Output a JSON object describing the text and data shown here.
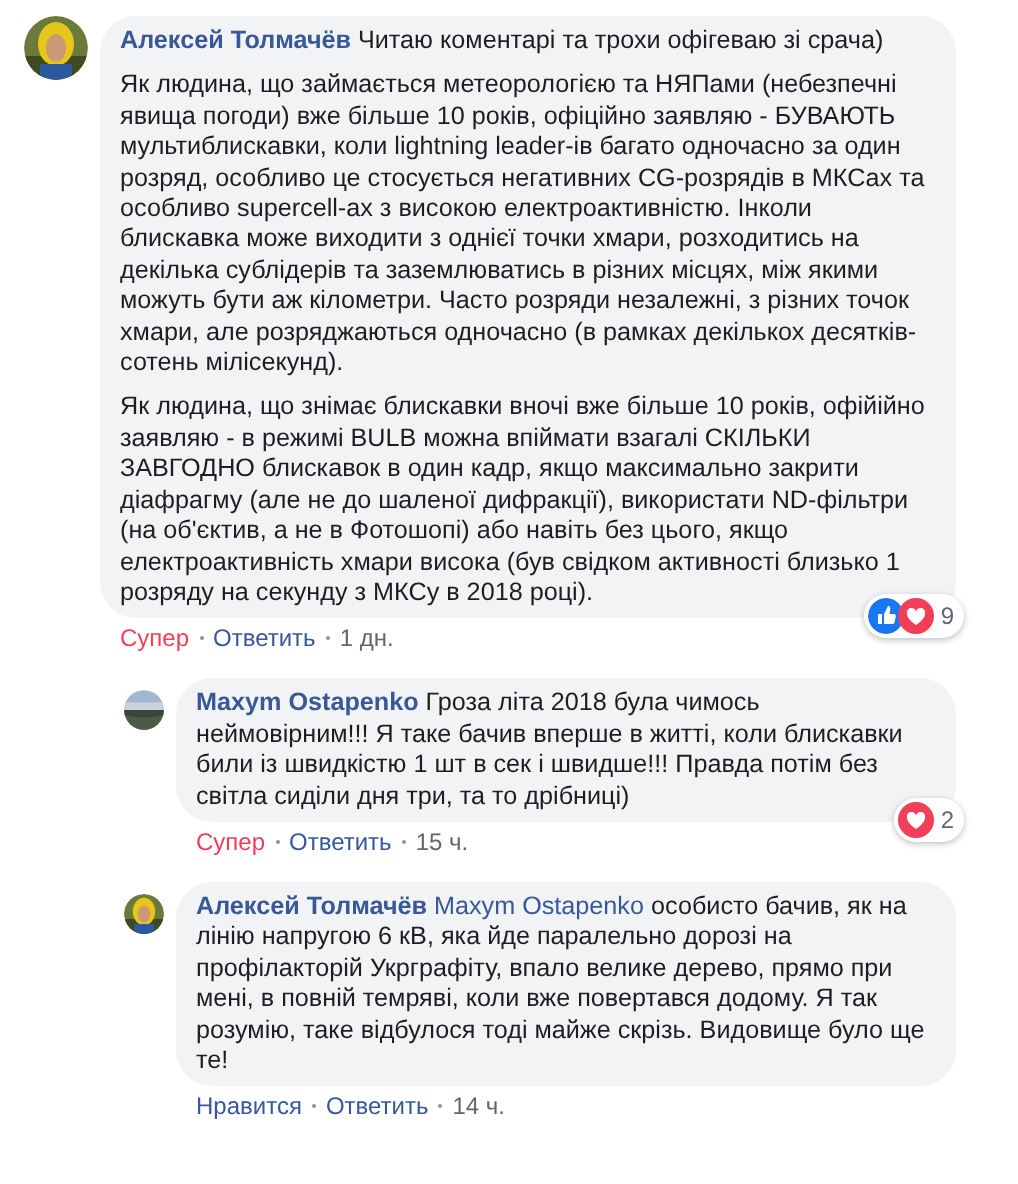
{
  "comments": [
    {
      "author": "Алексей Толмачёв",
      "paragraphs": [
        "Читаю коментарі та трохи офігеваю зі срача)",
        "Як людина, що займається метеорологією та НЯПами (небезпечні явища погоди) вже більше 10 років, офіційно заявляю - БУВАЮТЬ мультиблискавки, коли lightning leader-ів багато одночасно за один розряд, особливо це стосується негативних CG-розрядів в МКСах та особливо supercell-ах з високою електроактивністю. Інколи блискавка може виходити з однієї точки хмари, розходитись на декілька сублідерів та заземлюватись в різних місцях, між якими можуть бути аж кілометри. Часто розряди незалежні, з різних точок хмари, але розряджаються одночасно (в рамках декількох десятків-сотень мілісекунд).",
        "Як людина, що знімає блискавки вночі вже більше 10 років, офійійно заявляю - в режимі BULB можна впіймати взагалі СКІЛЬКИ ЗАВГОДНО блискавок в один кадр, якщо максимально закрити діафрагму (але не до шаленої дифракції), використати ND-фільтри (на об'єктив, а не в Фотошопі) або навіть без цього, якщо електроактивність хмари висока (був свідком активності близько 1 розряду на секунду з МКСу в 2018 році)."
      ],
      "reply": false,
      "actions": {
        "react": "Супер",
        "reacted": true,
        "reply": "Ответить",
        "time": "1 дн."
      },
      "reactions": {
        "icons": [
          {
            "kind": "like"
          },
          {
            "kind": "love"
          }
        ],
        "count": "9"
      }
    },
    {
      "author": "Maxym Ostapenko",
      "paragraphs": [
        "Гроза літа 2018 була чимось неймовірним!!! Я таке бачив вперше в житті, коли блискавки били із швидкістю 1 шт в сек і швидше!!! Правда потім без світла сиділи дня три, та то дрібниці)"
      ],
      "reply": true,
      "actions": {
        "react": "Супер",
        "reacted": true,
        "reply": "Ответить",
        "time": "15 ч."
      },
      "reactions": {
        "icons": [
          {
            "kind": "love"
          }
        ],
        "count": "2"
      }
    },
    {
      "author": "Алексей Толмачёв",
      "mention": "Maxym Ostapenko",
      "paragraphs": [
        "особисто бачив, як на лінію напругою 6 кВ, яка йде паралельно дорозі на профілакторій Укрграфіту, впало велике дерево, прямо при мені, в повній темряві, коли вже повертався додому. Я так розумію, таке відбулося тоді майже скрізь. Видовище було ще те!"
      ],
      "reply": true,
      "actions": {
        "react": "Нравится",
        "reacted": false,
        "reply": "Ответить",
        "time": "14 ч."
      }
    }
  ]
}
